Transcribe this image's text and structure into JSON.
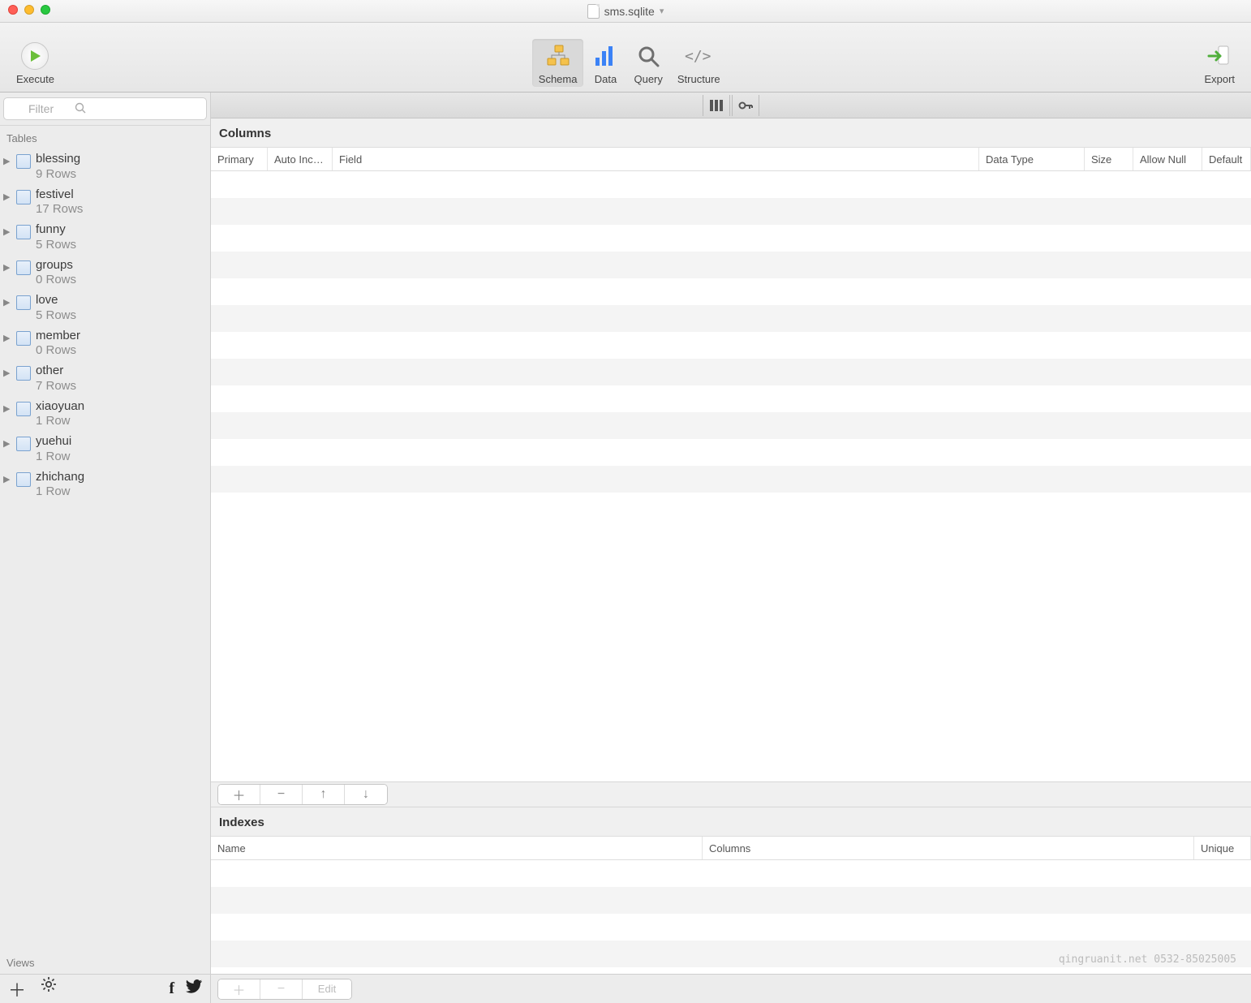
{
  "title": {
    "filename": "sms.sqlite"
  },
  "toolbar": {
    "execute": "Execute",
    "schema": "Schema",
    "data": "Data",
    "query": "Query",
    "structure": "Structure",
    "export": "Export"
  },
  "sidebar": {
    "filter_placeholder": "Filter",
    "tables_label": "Tables",
    "views_label": "Views",
    "tables": [
      {
        "name": "blessing",
        "rows": "9 Rows"
      },
      {
        "name": "festivel",
        "rows": "17 Rows"
      },
      {
        "name": "funny",
        "rows": "5 Rows"
      },
      {
        "name": "groups",
        "rows": "0 Rows"
      },
      {
        "name": "love",
        "rows": "5 Rows"
      },
      {
        "name": "member",
        "rows": "0 Rows"
      },
      {
        "name": "other",
        "rows": "7 Rows"
      },
      {
        "name": "xiaoyuan",
        "rows": "1 Row"
      },
      {
        "name": "yuehui",
        "rows": "1 Row"
      },
      {
        "name": "zhichang",
        "rows": "1 Row"
      }
    ]
  },
  "main": {
    "columns_title": "Columns",
    "indexes_title": "Indexes",
    "col_headers": {
      "primary": "Primary",
      "auto_inc": "Auto Inc…",
      "field": "Field",
      "data_type": "Data Type",
      "size": "Size",
      "allow_null": "Allow Null",
      "default": "Default"
    },
    "idx_headers": {
      "name": "Name",
      "columns": "Columns",
      "unique": "Unique"
    },
    "edit_label": "Edit"
  },
  "watermark": "qingruanit.net 0532-85025005"
}
